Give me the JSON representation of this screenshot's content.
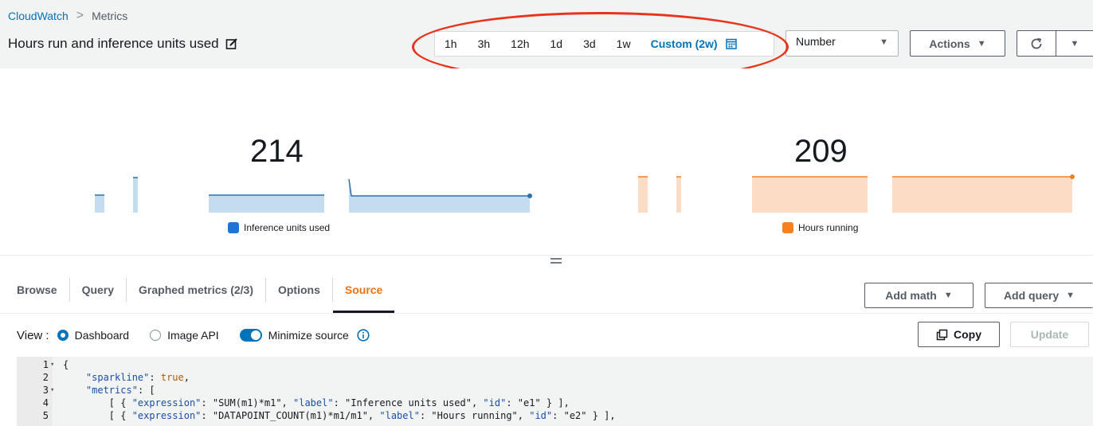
{
  "breadcrumb": {
    "root": "CloudWatch",
    "separator": ">",
    "current": "Metrics"
  },
  "page_title": "Hours run and inference units used",
  "time_range": {
    "options": [
      "1h",
      "3h",
      "12h",
      "1d",
      "3d",
      "1w"
    ],
    "selected": "Custom (2w)"
  },
  "widget_type_select": {
    "value": "Number"
  },
  "actions_label": "Actions",
  "colors": {
    "blue": "#2f6fad",
    "blue_fill": "#c4dcef",
    "orange": "#f7811e",
    "orange_fill": "#fcdcc5",
    "accent": "#ec7211",
    "link": "#0073bb"
  },
  "metrics": [
    {
      "value": "214",
      "label": "Inference units used",
      "color": "#2074d5"
    },
    {
      "value": "209",
      "label": "Hours running",
      "color": "#f7811e"
    }
  ],
  "tabs": [
    {
      "label": "Browse"
    },
    {
      "label": "Query"
    },
    {
      "label": "Graphed metrics (2/3)"
    },
    {
      "label": "Options"
    },
    {
      "label": "Source",
      "active": true
    }
  ],
  "add_math_label": "Add math",
  "add_query_label": "Add query",
  "view": {
    "label": "View :",
    "dashboard_label": "Dashboard",
    "image_api_label": "Image API",
    "minimize_label": "Minimize source"
  },
  "copy_label": "Copy",
  "update_label": "Update",
  "code_lines": [
    {
      "n": "1",
      "fold": true,
      "text": "{"
    },
    {
      "n": "2",
      "fold": false,
      "text": "    \"sparkline\": true,"
    },
    {
      "n": "3",
      "fold": true,
      "text": "    \"metrics\": ["
    },
    {
      "n": "4",
      "fold": false,
      "text": "        [ { \"expression\": \"SUM(m1)*m1\", \"label\": \"Inference units used\", \"id\": \"e1\" } ],"
    },
    {
      "n": "5",
      "fold": false,
      "text": "        [ { \"expression\": \"DATAPOINT_COUNT(m1)*m1/m1\", \"label\": \"Hours running\", \"id\": \"e2\" } ],"
    }
  ]
}
